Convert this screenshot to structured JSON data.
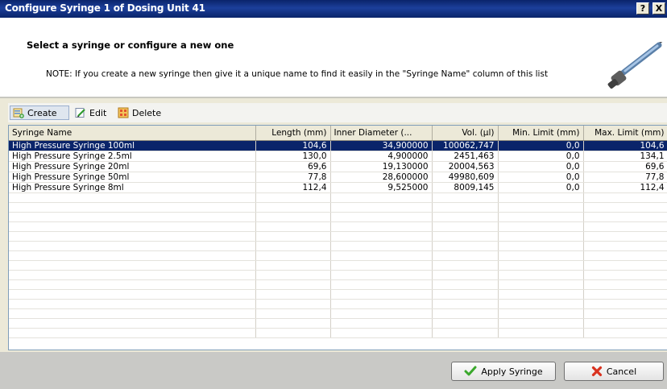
{
  "window": {
    "title": "Configure Syringe 1 of Dosing Unit 41",
    "help_label": "?",
    "close_label": "X"
  },
  "header": {
    "title": "Select a syringe or configure a new one",
    "note": "NOTE: If you create a new syringe then give it a unique name to find it easily in the \"Syringe Name\" column of this list"
  },
  "toolbar": {
    "create_label": "Create",
    "edit_label": "Edit",
    "delete_label": "Delete"
  },
  "table": {
    "columns": [
      "Syringe Name",
      "Length (mm)",
      "Inner Diameter (...",
      "Vol. (µl)",
      "Min. Limit (mm)",
      "Max. Limit (mm)"
    ],
    "rows": [
      [
        "High Pressure Syringe 100ml",
        "104,6",
        "34,900000",
        "100062,747",
        "0,0",
        "104,6"
      ],
      [
        "High Pressure Syringe 2.5ml",
        "130,0",
        "4,900000",
        "2451,463",
        "0,0",
        "134,1"
      ],
      [
        "High Pressure Syringe 20ml",
        "69,6",
        "19,130000",
        "20004,563",
        "0,0",
        "69,6"
      ],
      [
        "High Pressure Syringe 50ml",
        "77,8",
        "28,600000",
        "49980,609",
        "0,0",
        "77,8"
      ],
      [
        "High Pressure Syringe 8ml",
        "112,4",
        "9,525000",
        "8009,145",
        "0,0",
        "112,4"
      ]
    ],
    "selected_row": 0
  },
  "footer": {
    "apply_label": "Apply Syringe",
    "cancel_label": "Cancel"
  },
  "colors": {
    "titlebar": "#0a246a",
    "selection": "#0a246a",
    "apply_icon": "#3aa82c",
    "cancel_icon": "#d9321f"
  },
  "icons": {
    "create": "create-icon",
    "edit": "edit-icon",
    "delete": "delete-icon",
    "apply": "checkmark-icon",
    "cancel": "x-mark-icon",
    "header": "syringe-icon"
  }
}
